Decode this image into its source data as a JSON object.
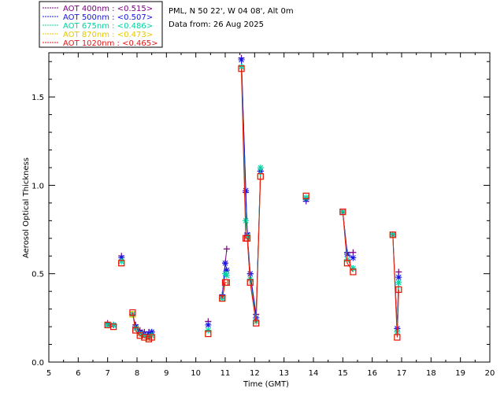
{
  "chart_data": {
    "type": "line",
    "site": "PML, N 50 22', W 04 08', Alt 0m",
    "date_text": "Data from: 26 Aug 2025",
    "xlabel": "Time (GMT)",
    "ylabel": "Aerosol Optical Thickness",
    "xlim": [
      5,
      20
    ],
    "ylim": [
      0,
      1.75
    ],
    "xticks": [
      "5",
      "6",
      "7",
      "8",
      "9",
      "10",
      "11",
      "12",
      "13",
      "14",
      "15",
      "16",
      "17",
      "18",
      "19",
      "20"
    ],
    "yticks": [
      "0.0",
      "0.5",
      "1.0",
      "1.5"
    ],
    "grid": false,
    "legend_position": "top-left outside",
    "series": [
      {
        "name": "AOT  400nm : <0.515>",
        "color": "#7b0082",
        "marker": "plus",
        "segments": [
          {
            "x": [
              7.0,
              7.2
            ],
            "y": [
              0.22,
              0.21
            ]
          },
          {
            "x": [
              7.47
            ],
            "y": [
              0.6
            ]
          },
          {
            "x": [
              7.85,
              7.95,
              8.1,
              8.25,
              8.4,
              8.5
            ],
            "y": [
              0.27,
              0.21,
              0.18,
              0.17,
              0.17,
              0.17
            ]
          },
          {
            "x": [
              10.42
            ],
            "y": [
              0.23
            ]
          },
          {
            "x": [
              10.9,
              11.0,
              11.05
            ],
            "y": [
              0.38,
              0.56,
              0.64
            ]
          },
          {
            "x": [
              11.55,
              11.7,
              11.75,
              11.85,
              12.05,
              12.2
            ],
            "y": [
              1.72,
              0.96,
              0.73,
              0.5,
              0.27,
              1.08
            ]
          },
          {
            "x": [
              13.75
            ],
            "y": [
              0.91
            ]
          },
          {
            "x": [
              15.0,
              15.15,
              15.35
            ],
            "y": [
              0.85,
              0.62,
              0.62
            ]
          },
          {
            "x": [
              16.7,
              16.85,
              16.9
            ],
            "y": [
              0.72,
              0.19,
              0.51
            ]
          }
        ]
      },
      {
        "name": "AOT  500nm : <0.507>",
        "color": "#1414e6",
        "marker": "star",
        "segments": [
          {
            "x": [
              7.0,
              7.2
            ],
            "y": [
              0.21,
              0.21
            ]
          },
          {
            "x": [
              7.47
            ],
            "y": [
              0.59
            ]
          },
          {
            "x": [
              7.85,
              7.95,
              8.1,
              8.25,
              8.4,
              8.5
            ],
            "y": [
              0.27,
              0.2,
              0.17,
              0.16,
              0.16,
              0.17
            ]
          },
          {
            "x": [
              10.42
            ],
            "y": [
              0.21
            ]
          },
          {
            "x": [
              10.9,
              11.0,
              11.05
            ],
            "y": [
              0.37,
              0.56,
              0.52
            ]
          },
          {
            "x": [
              11.55,
              11.7,
              11.75,
              11.85,
              12.05,
              12.2
            ],
            "y": [
              1.71,
              0.97,
              0.72,
              0.5,
              0.25,
              1.08
            ]
          },
          {
            "x": [
              13.75
            ],
            "y": [
              0.92
            ]
          },
          {
            "x": [
              15.0,
              15.15,
              15.35
            ],
            "y": [
              0.85,
              0.61,
              0.59
            ]
          },
          {
            "x": [
              16.7,
              16.85,
              16.9
            ],
            "y": [
              0.72,
              0.19,
              0.48
            ]
          }
        ]
      },
      {
        "name": "AOT  675nm : <0.486>",
        "color": "#00d2a0",
        "marker": "star",
        "segments": [
          {
            "x": [
              7.0,
              7.2
            ],
            "y": [
              0.21,
              0.21
            ]
          },
          {
            "x": [
              7.47
            ],
            "y": [
              0.57
            ]
          },
          {
            "x": [
              7.85,
              7.95,
              8.1,
              8.25,
              8.4,
              8.5
            ],
            "y": [
              0.27,
              0.19,
              0.16,
              0.15,
              0.14,
              0.15
            ]
          },
          {
            "x": [
              10.42
            ],
            "y": [
              0.18
            ]
          },
          {
            "x": [
              10.9,
              11.0,
              11.05
            ],
            "y": [
              0.36,
              0.5,
              0.49
            ]
          },
          {
            "x": [
              11.55,
              11.7,
              11.75,
              11.85,
              12.05,
              12.2
            ],
            "y": [
              1.67,
              0.8,
              0.71,
              0.47,
              0.23,
              1.1
            ]
          },
          {
            "x": [
              13.75
            ],
            "y": [
              0.93
            ]
          },
          {
            "x": [
              15.0,
              15.15,
              15.35
            ],
            "y": [
              0.85,
              0.58,
              0.53
            ]
          },
          {
            "x": [
              16.7,
              16.85,
              16.9
            ],
            "y": [
              0.72,
              0.17,
              0.45
            ]
          }
        ]
      },
      {
        "name": "AOT  870nm : <0.473>",
        "color": "#e6c800",
        "marker": "square",
        "segments": [
          {
            "x": [
              7.0,
              7.2
            ],
            "y": [
              0.21,
              0.2
            ]
          },
          {
            "x": [
              7.47
            ],
            "y": [
              0.56
            ]
          },
          {
            "x": [
              7.85,
              7.95,
              8.1,
              8.25,
              8.4,
              8.5
            ],
            "y": [
              0.27,
              0.18,
              0.15,
              0.14,
              0.13,
              0.14
            ]
          },
          {
            "x": [
              10.42
            ],
            "y": [
              0.16
            ]
          },
          {
            "x": [
              10.9,
              11.0,
              11.05
            ],
            "y": [
              0.36,
              0.45,
              0.45
            ]
          },
          {
            "x": [
              11.55,
              11.7,
              11.75,
              11.85,
              12.05,
              12.2
            ],
            "y": [
              1.66,
              0.7,
              0.7,
              0.45,
              0.22,
              1.05
            ]
          },
          {
            "x": [
              13.75
            ],
            "y": [
              0.94
            ]
          },
          {
            "x": [
              15.0,
              15.15,
              15.35
            ],
            "y": [
              0.85,
              0.56,
              0.51
            ]
          },
          {
            "x": [
              16.7,
              16.85,
              16.9
            ],
            "y": [
              0.72,
              0.14,
              0.41
            ]
          }
        ]
      },
      {
        "name": "AOT 1020nm : <0.465>",
        "color": "#e61414",
        "marker": "square",
        "segments": [
          {
            "x": [
              7.0,
              7.2
            ],
            "y": [
              0.21,
              0.2
            ]
          },
          {
            "x": [
              7.47
            ],
            "y": [
              0.56
            ]
          },
          {
            "x": [
              7.85,
              7.95,
              8.1,
              8.25,
              8.4,
              8.5
            ],
            "y": [
              0.28,
              0.18,
              0.15,
              0.14,
              0.13,
              0.14
            ]
          },
          {
            "x": [
              10.42
            ],
            "y": [
              0.16
            ]
          },
          {
            "x": [
              10.9,
              11.0,
              11.05
            ],
            "y": [
              0.36,
              0.45,
              0.45
            ]
          },
          {
            "x": [
              11.55,
              11.7,
              11.75,
              11.85,
              12.05,
              12.2
            ],
            "y": [
              1.66,
              0.7,
              0.7,
              0.45,
              0.22,
              1.05
            ]
          },
          {
            "x": [
              13.75
            ],
            "y": [
              0.94
            ]
          },
          {
            "x": [
              15.0,
              15.15,
              15.35
            ],
            "y": [
              0.85,
              0.56,
              0.51
            ]
          },
          {
            "x": [
              16.7,
              16.85,
              16.9
            ],
            "y": [
              0.72,
              0.14,
              0.41
            ]
          }
        ]
      }
    ]
  }
}
